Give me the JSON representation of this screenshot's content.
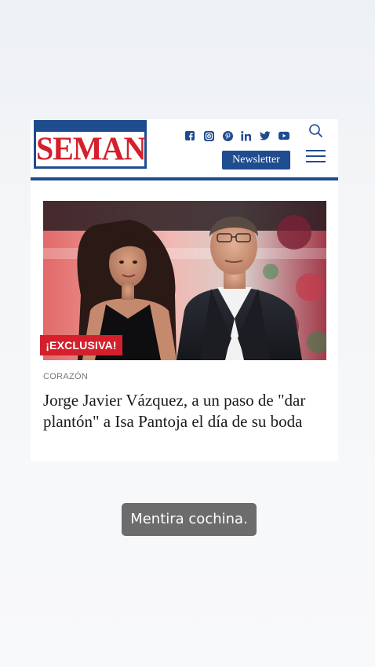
{
  "site": {
    "logo_text": "SEMANA",
    "social_icons": [
      "facebook-icon",
      "instagram-icon",
      "pinterest-icon",
      "linkedin-icon",
      "twitter-icon",
      "youtube-icon"
    ],
    "newsletter_label": "Newsletter",
    "brand_color": "#1f4c8f",
    "accent_color": "#d4202c"
  },
  "article": {
    "badge": "¡EXCLUSIVA!",
    "section": "CORAZÓN",
    "headline": "Jorge Javier Vázquez, a un paso de \"dar plantón\" a Isa Pantoja el día de su boda"
  },
  "story": {
    "caption": "Mentira cochina."
  }
}
